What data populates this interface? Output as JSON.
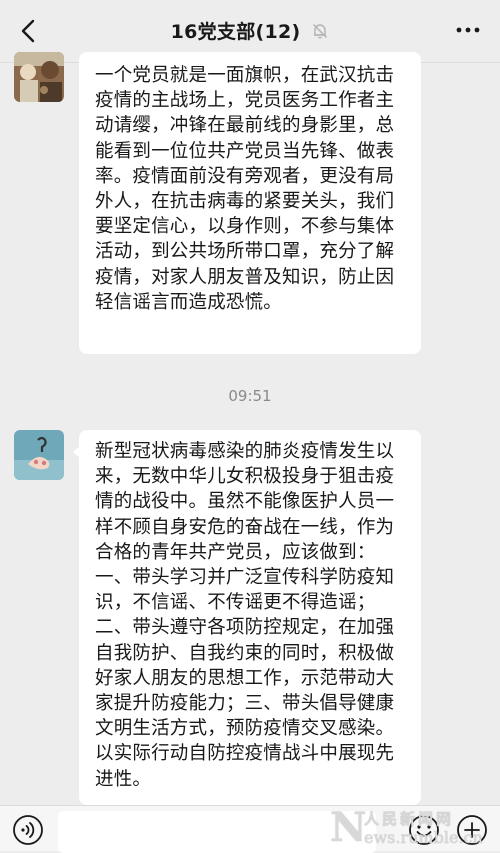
{
  "header": {
    "title": "16党支部(12)",
    "back_icon": "chevron-left-icon",
    "mute_icon": "bell-off-icon",
    "more_icon": "more-dots-icon"
  },
  "messages": [
    {
      "text": "一个党员就是一面旗帜，在武汉抗击疫情的主战场上，党员医务工作者主动请缨，冲锋在最前线的身影里，总能看到一位位共产党员当先锋、做表率。疫情面前没有旁观者，更没有局外人，在抗击病毒的紧要关头，我们要坚定信心，以身作则，不参与集体活动，到公共场所带口罩，充分了解疫情，对家人朋友普及知识，防止因轻信谣言而造成恐慌。"
    },
    {
      "text": "新型冠状病毒感染的肺炎疫情发生以来，无数中华儿女积极投身于狙击疫情的战役中。虽然不能像医护人员一样不顾自身安危的奋战在一线，作为合格的青年共产党员，应该做到：一、带头学习并广泛宣传科学防疫知识，不信谣、不传谣更不得造谣；二、带头遵守各项防控规定，在加强自我防护、自我约束的同时，积极做好家人朋友的思想工作，示范带动大家提升防疫能力；三、带头倡导健康文明生活方式，预防疫情交叉感染。以实际行动自防控疫情战斗中展现先进性。"
    }
  ],
  "timestamp": "09:51",
  "input_bar": {
    "voice_icon": "voice-icon",
    "emoji_icon": "emoji-icon",
    "plus_icon": "plus-icon"
  },
  "watermark": {
    "letter": "N",
    "cn": "人民新闻网",
    "en": "ews.rumble.cn"
  },
  "colors": {
    "background": "#ededed",
    "bubble": "#ffffff",
    "text": "#191919",
    "timestamp": "#8a8a8a"
  }
}
